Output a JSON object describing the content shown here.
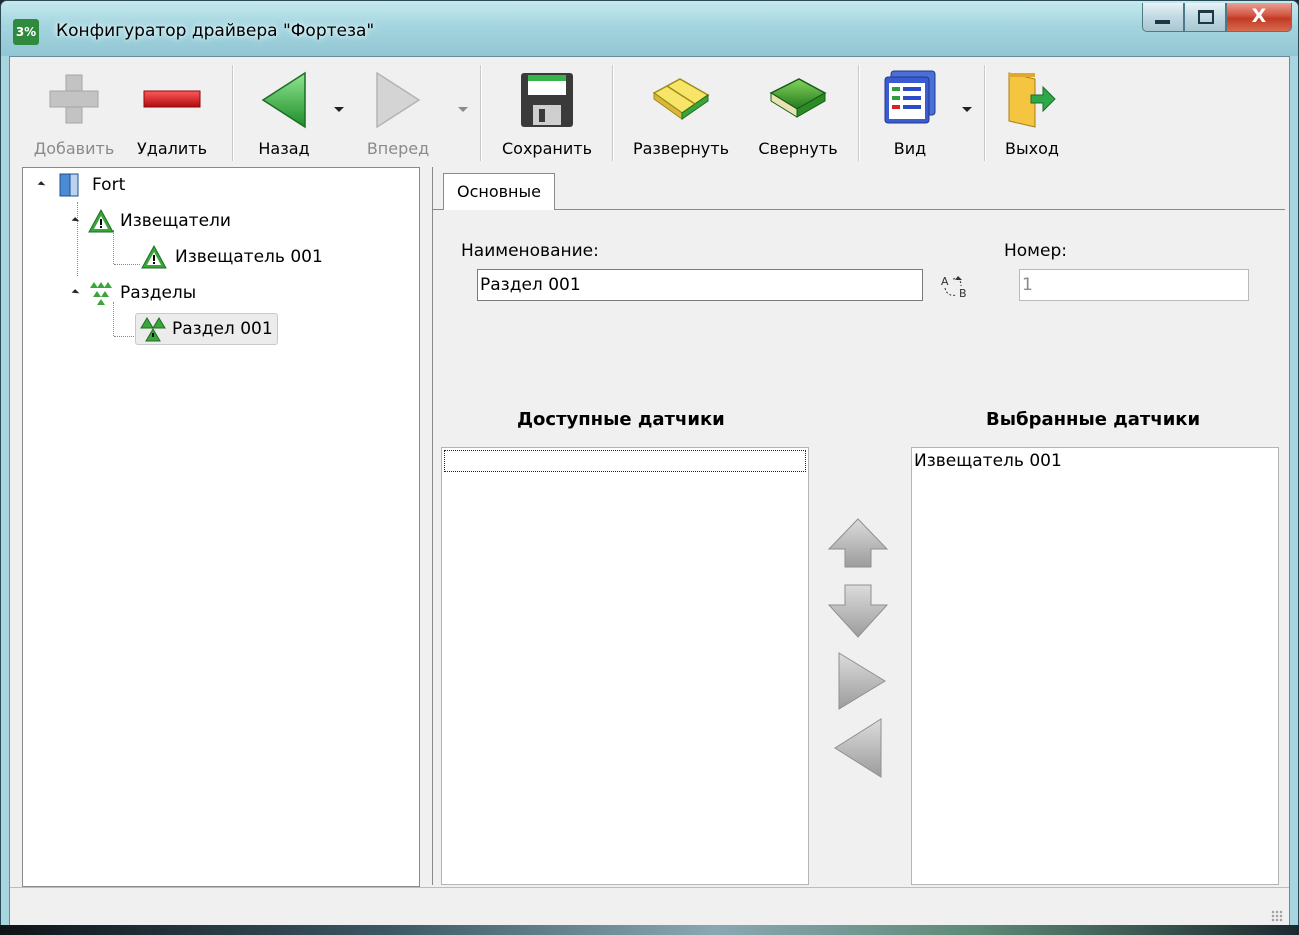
{
  "window": {
    "title": "Конфигуратор драйвера \"Фортеза\"",
    "icon_text": "3%",
    "close_symbol": "X"
  },
  "toolbar": {
    "add_label": "Добавить",
    "delete_label": "Удалить",
    "back_label": "Назад",
    "forward_label": "Вперед",
    "save_label": "Сохранить",
    "expand_label": "Развернуть",
    "collapse_label": "Свернуть",
    "view_label": "Вид",
    "exit_label": "Выход"
  },
  "tree": {
    "root": "Fort",
    "detectors_group": "Извещатели",
    "detector_item": "Извещатель 001",
    "sections_group": "Разделы",
    "section_item": "Раздел 001"
  },
  "tabs": {
    "main_tab": "Основные"
  },
  "form": {
    "name_label": "Наименование:",
    "name_value": "Раздел 001",
    "number_label": "Номер:",
    "number_value": "1",
    "available_title": "Доступные датчики",
    "selected_title": "Выбранные датчики",
    "available_items": [],
    "selected_items": [
      "Извещатель 001"
    ]
  },
  "colors": {
    "accent_green": "#3aa63a",
    "delete_red": "#d9181e",
    "titlebar": "#a4d5df"
  }
}
